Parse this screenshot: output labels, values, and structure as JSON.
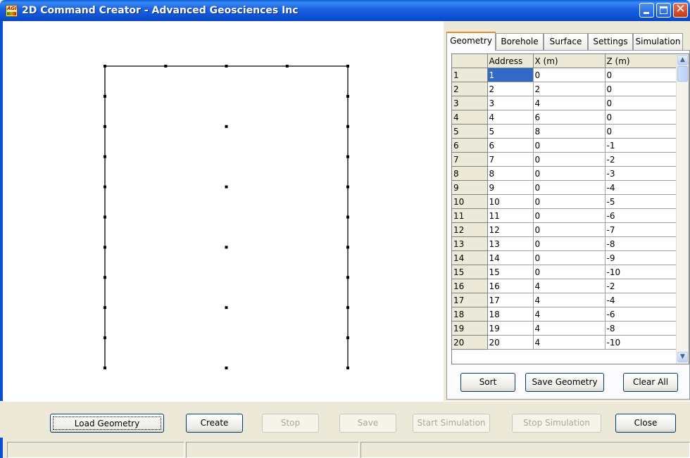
{
  "window": {
    "title": "2D Command Creator - Advanced Geosciences Inc",
    "icon_text": "AGI",
    "icon": "agi-app-icon"
  },
  "title_buttons": {
    "minimize": "minimize-icon",
    "maximize": "maximize-icon",
    "close": "close-icon"
  },
  "tabs": [
    "Geometry",
    "Borehole",
    "Surface",
    "Settings",
    "Simulation"
  ],
  "active_tab": "Geometry",
  "table": {
    "columns": [
      "Address",
      "X (m)",
      "Z (m)"
    ],
    "rows": [
      [
        "1",
        "1",
        "0",
        "0"
      ],
      [
        "2",
        "2",
        "2",
        "0"
      ],
      [
        "3",
        "3",
        "4",
        "0"
      ],
      [
        "4",
        "4",
        "6",
        "0"
      ],
      [
        "5",
        "5",
        "8",
        "0"
      ],
      [
        "6",
        "6",
        "0",
        "-1"
      ],
      [
        "7",
        "7",
        "0",
        "-2"
      ],
      [
        "8",
        "8",
        "0",
        "-3"
      ],
      [
        "9",
        "9",
        "0",
        "-4"
      ],
      [
        "10",
        "10",
        "0",
        "-5"
      ],
      [
        "11",
        "11",
        "0",
        "-6"
      ],
      [
        "12",
        "12",
        "0",
        "-7"
      ],
      [
        "13",
        "13",
        "0",
        "-8"
      ],
      [
        "14",
        "14",
        "0",
        "-9"
      ],
      [
        "15",
        "15",
        "0",
        "-10"
      ],
      [
        "16",
        "16",
        "4",
        "-2"
      ],
      [
        "17",
        "17",
        "4",
        "-4"
      ],
      [
        "18",
        "18",
        "4",
        "-6"
      ],
      [
        "19",
        "19",
        "4",
        "-8"
      ],
      [
        "20",
        "20",
        "4",
        "-10"
      ]
    ]
  },
  "panel_buttons": {
    "sort": "Sort",
    "save_geometry": "Save Geometry",
    "clear_all": "Clear All"
  },
  "bottom_buttons": {
    "load_geometry": "Load Geometry",
    "create": "Create",
    "stop": "Stop",
    "save": "Save",
    "start_simulation": "Start Simulation",
    "stop_simulation": "Stop Simulation",
    "close": "Close"
  },
  "colors": {
    "title_bar": "#0b4fd0",
    "selection": "#316ac5",
    "tab_highlight": "#e68b2c"
  }
}
